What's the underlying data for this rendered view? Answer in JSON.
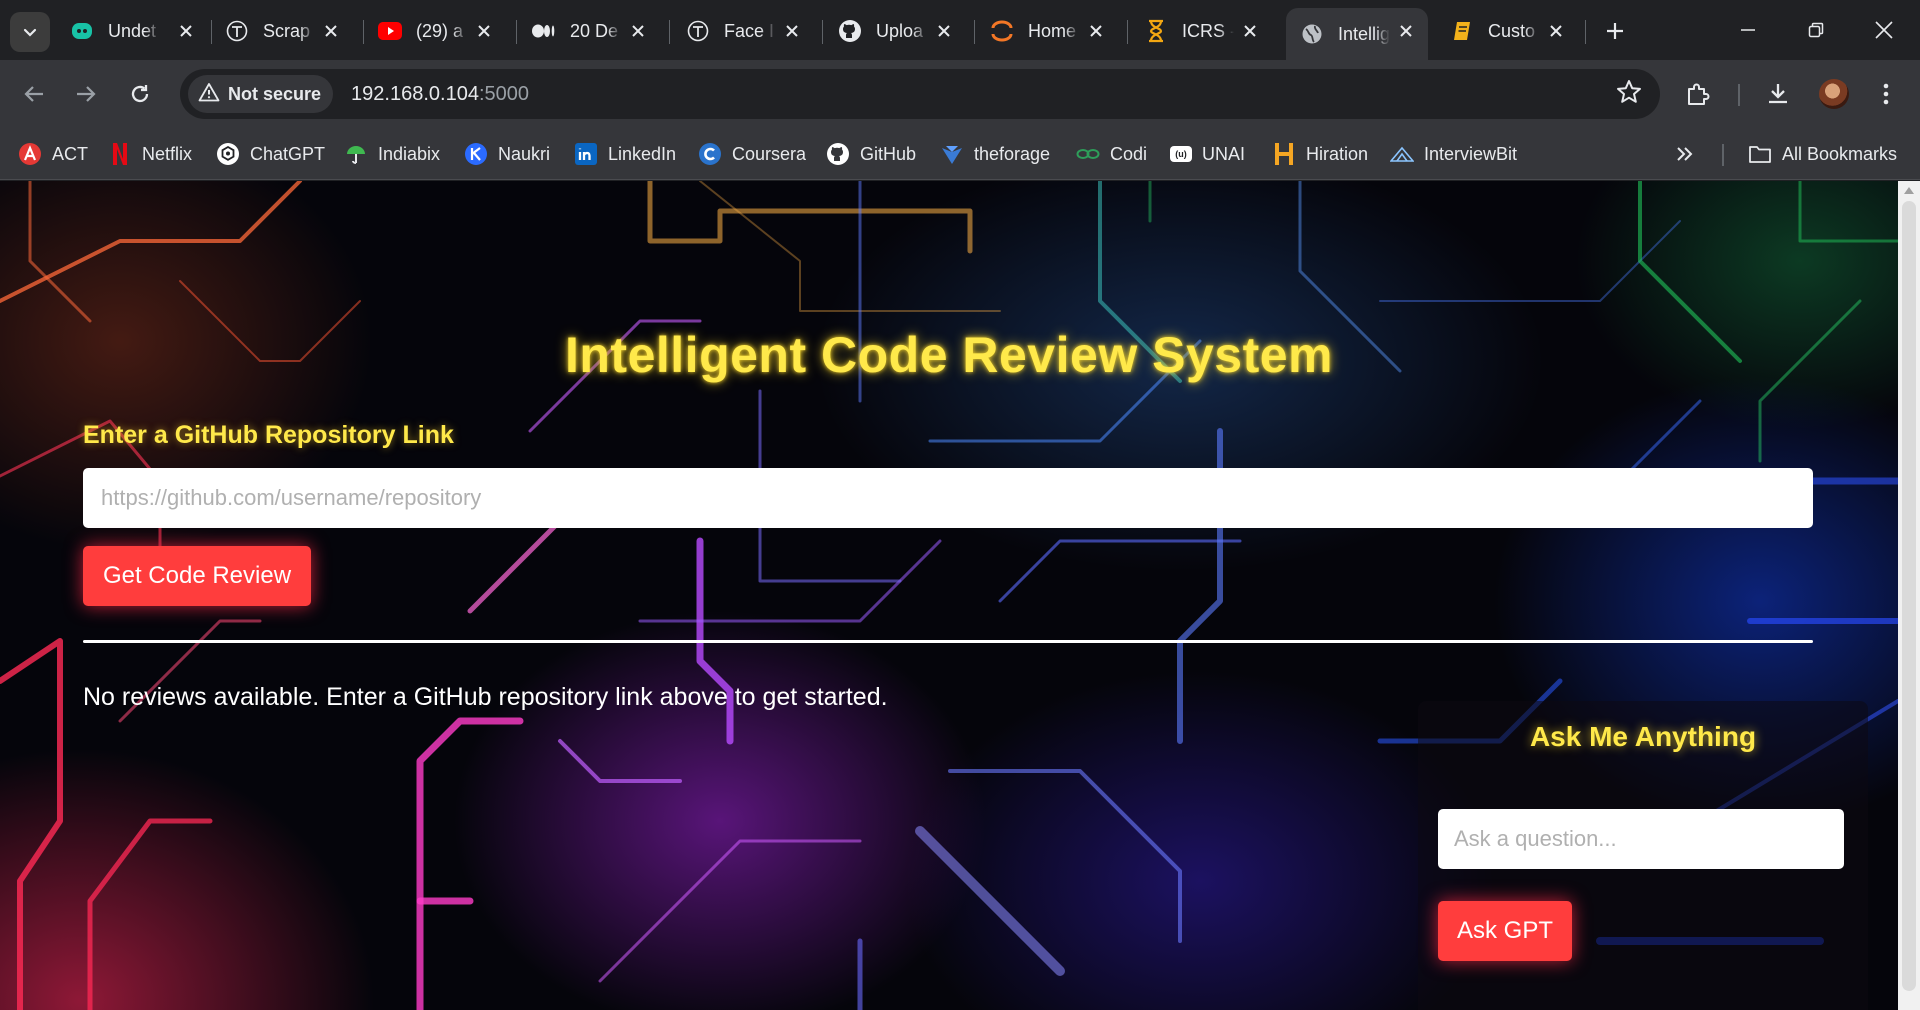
{
  "browser": {
    "tabs": [
      {
        "title": "Undet",
        "icon": "undetectable-ai-icon",
        "color": "#18c2a6"
      },
      {
        "title": "Scrap",
        "icon": "typedream-icon",
        "color": "#e8eaed"
      },
      {
        "title": "(29) a",
        "icon": "youtube-icon",
        "color": "#ff0000"
      },
      {
        "title": "20 De",
        "icon": "medium-icon",
        "color": "#e8eaed"
      },
      {
        "title": "Face I",
        "icon": "typedream-icon",
        "color": "#e8eaed"
      },
      {
        "title": "Uploa",
        "icon": "github-icon",
        "color": "#e8eaed"
      },
      {
        "title": "Home",
        "icon": "jupyter-icon",
        "color": "#f37726"
      },
      {
        "title": "ICRS -",
        "icon": "hourglass-icon",
        "color": "#f3a712"
      },
      {
        "title": "Intellig",
        "icon": "globe-icon",
        "color": "#bdc1c6",
        "active": true
      },
      {
        "title": "Custo",
        "icon": "notebook-icon",
        "color": "#f3b21b"
      }
    ],
    "address": {
      "security_label": "Not secure",
      "host": "192.168.0.104",
      "port": ":5000"
    },
    "bookmarks": [
      {
        "label": "ACT",
        "icon": "act-icon",
        "color": "#e53935"
      },
      {
        "label": "Netflix",
        "icon": "netflix-icon",
        "color": "#e50914"
      },
      {
        "label": "ChatGPT",
        "icon": "chatgpt-icon",
        "color": "#ffffff"
      },
      {
        "label": "Indiabix",
        "icon": "indiabix-icon",
        "color": "#3fb950"
      },
      {
        "label": "Naukri",
        "icon": "naukri-icon",
        "color": "#2b6bff"
      },
      {
        "label": "LinkedIn",
        "icon": "linkedin-icon",
        "color": "#0a66c2"
      },
      {
        "label": "Coursera",
        "icon": "coursera-icon",
        "color": "#2a73cc"
      },
      {
        "label": "GitHub",
        "icon": "github-icon",
        "color": "#ffffff"
      },
      {
        "label": "theforage",
        "icon": "theforage-icon",
        "color": "#3a7bd5"
      },
      {
        "label": "Codi",
        "icon": "codingninjas-icon",
        "color": "#2e9e5a"
      },
      {
        "label": "UNAI",
        "icon": "unai-icon",
        "color": "#ffffff"
      },
      {
        "label": "Hiration",
        "icon": "hiration-icon",
        "color": "#f5a623"
      },
      {
        "label": "InterviewBit",
        "icon": "interviewbit-icon",
        "color": "#8bc5ff"
      }
    ],
    "all_bookmarks_label": "All Bookmarks"
  },
  "page": {
    "title": "Intelligent Code Review System",
    "repo_label": "Enter a GitHub Repository Link",
    "repo_placeholder": "https://github.com/username/repository",
    "review_button": "Get Code Review",
    "empty_message": "No reviews available. Enter a GitHub repository link above to get started.",
    "chat": {
      "title": "Ask Me Anything",
      "placeholder": "Ask a question...",
      "button": "Ask GPT"
    }
  },
  "colors": {
    "accent_yellow": "#ffe94a",
    "button_red": "#ff3d3d"
  }
}
